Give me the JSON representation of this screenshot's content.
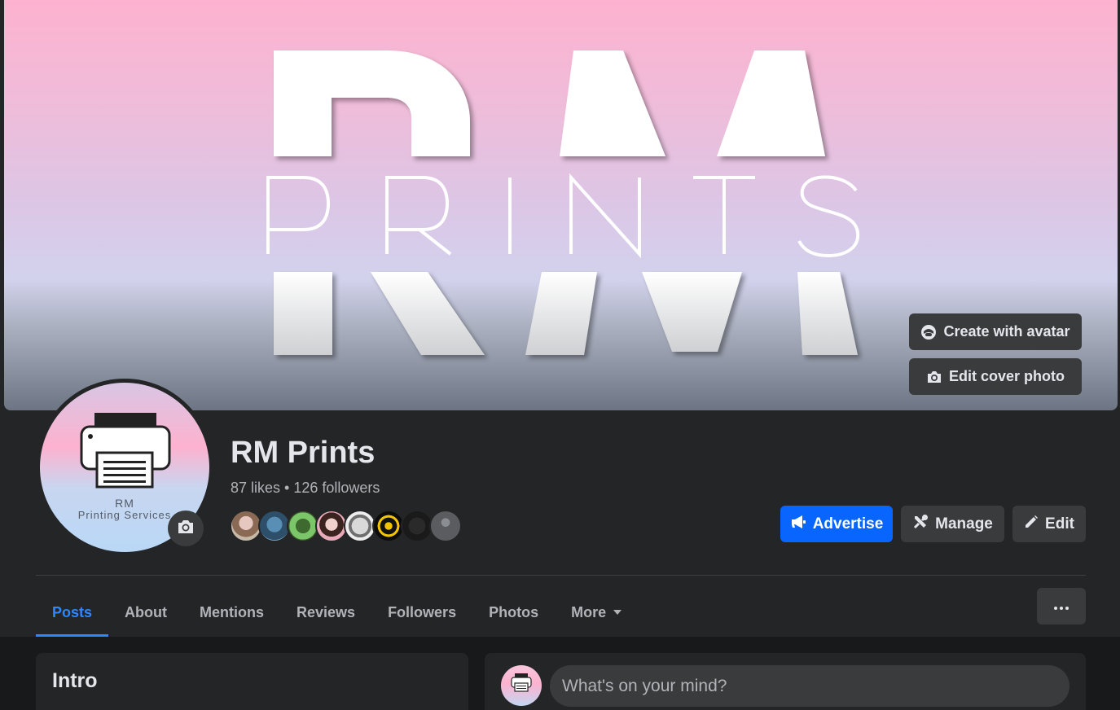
{
  "cover": {
    "buttons": {
      "create_avatar": "Create with avatar",
      "edit_cover": "Edit cover photo"
    }
  },
  "profile": {
    "avatar_line1": "RM",
    "avatar_line2": "Printing Services",
    "name": "RM Prints",
    "stats": "87 likes • 126 followers"
  },
  "actions": {
    "advertise": "Advertise",
    "manage": "Manage",
    "edit": "Edit"
  },
  "tabs": [
    {
      "label": "Posts",
      "active": true
    },
    {
      "label": "About"
    },
    {
      "label": "Mentions"
    },
    {
      "label": "Reviews"
    },
    {
      "label": "Followers"
    },
    {
      "label": "Photos"
    },
    {
      "label": "More"
    }
  ],
  "intro": {
    "title": "Intro"
  },
  "composer": {
    "placeholder": "What's on your mind?"
  },
  "colors": {
    "accent": "#0866ff",
    "tab_active": "#2d88ff",
    "surface": "#242526",
    "button": "#3a3b3c"
  }
}
